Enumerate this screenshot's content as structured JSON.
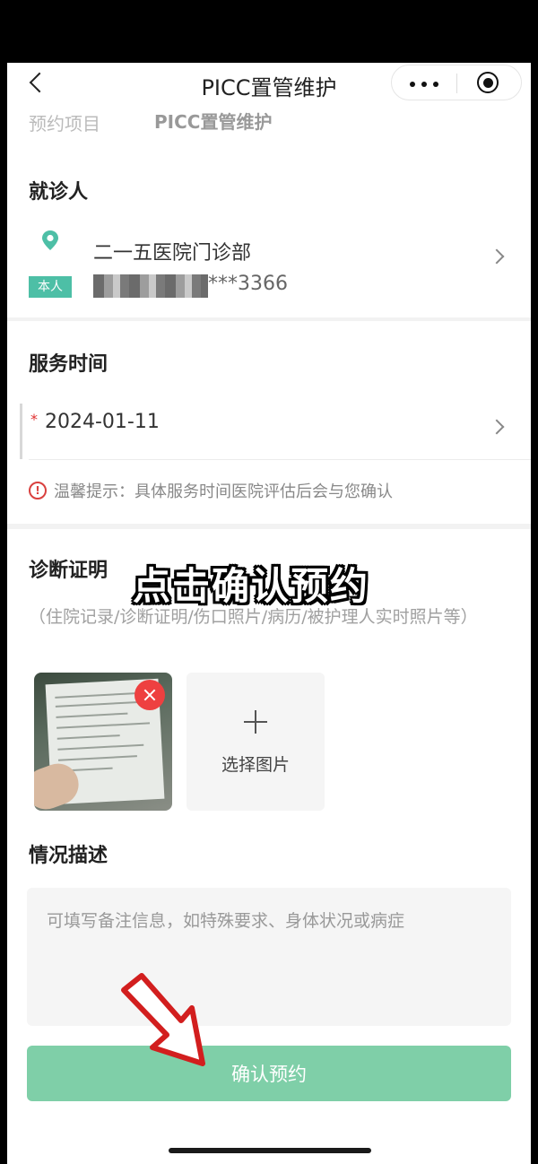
{
  "nav": {
    "title": "PICC置管维护"
  },
  "project": {
    "label": "预约项目",
    "value": "PICC置管维护"
  },
  "patient": {
    "section_title": "就诊人",
    "hospital": "二一五医院门诊部",
    "badge": "本人",
    "phone_masked": "***3366"
  },
  "service": {
    "section_title": "服务时间",
    "required_mark": "*",
    "date": "2024-01-11",
    "tip_icon": "!",
    "tip": "温馨提示：具体服务时间医院评估后会与您确认"
  },
  "diagnosis": {
    "section_title": "诊断证明",
    "hint": "（住院记录/诊断证明/伤口照片/病历/被护理人实时照片等）",
    "picker_label": "选择图片"
  },
  "description": {
    "section_title": "情况描述",
    "placeholder": "可填写备注信息，如特殊要求、身体状况或病症"
  },
  "actions": {
    "confirm_label": "确认预约"
  },
  "overlay": {
    "caption": "点击确认预约"
  },
  "colors": {
    "accent": "#4dbfa6",
    "confirm_button": "#7fcfa8",
    "danger": "#ee4040"
  }
}
